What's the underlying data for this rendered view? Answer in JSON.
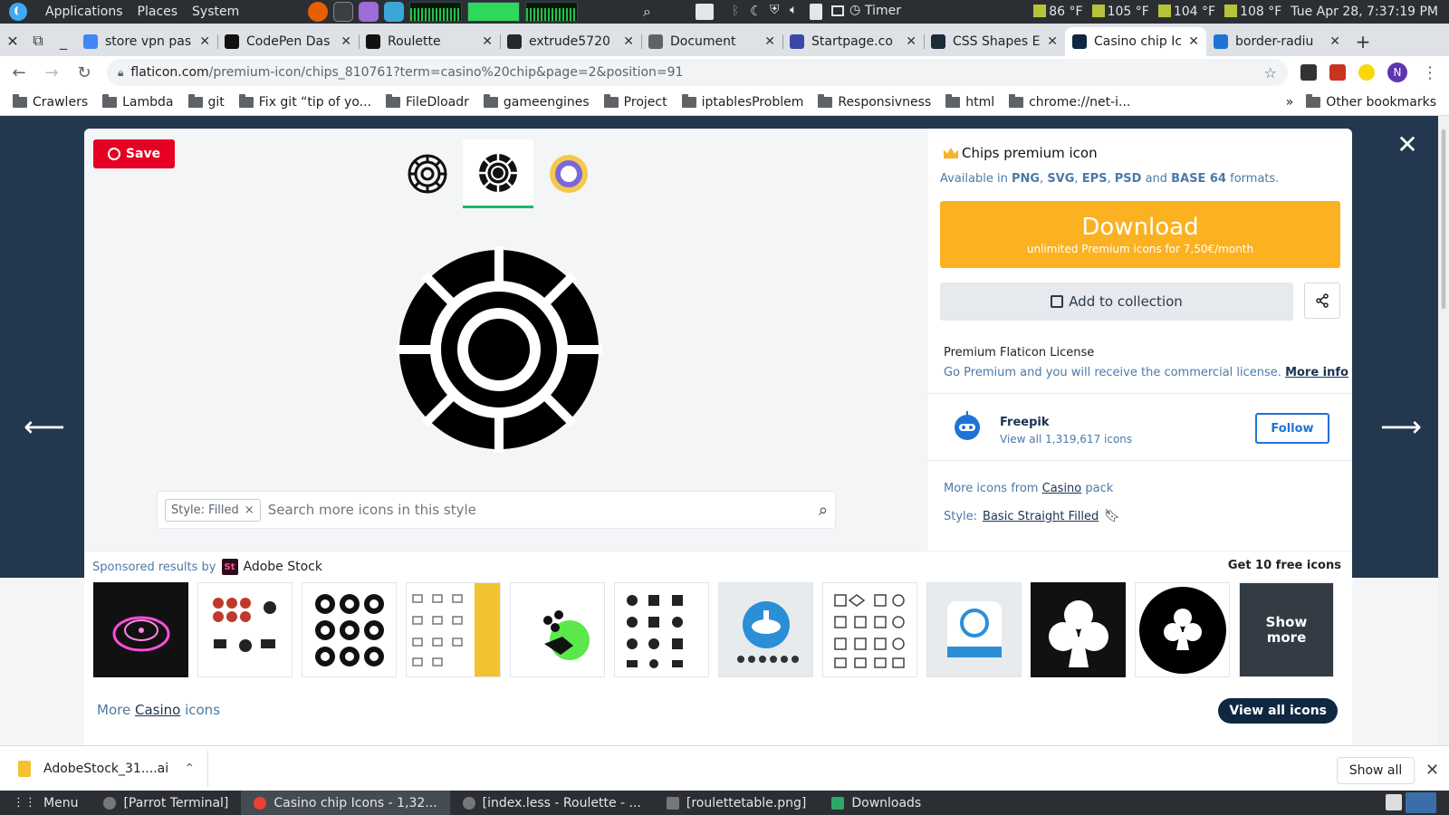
{
  "os_panel": {
    "menus": [
      "Applications",
      "Places",
      "System"
    ],
    "timer_label": "Timer",
    "temps": [
      "86 °F",
      "105 °F",
      "104 °F",
      "108 °F"
    ],
    "clock": "Tue Apr 28, 7:37:19 PM"
  },
  "tabs": [
    {
      "title": "store vpn pas",
      "fav_color": "#4285f4"
    },
    {
      "title": "CodePen Das",
      "fav_color": "#111111"
    },
    {
      "title": "Roulette",
      "fav_color": "#111111"
    },
    {
      "title": "extrude5720",
      "fav_color": "#24292e"
    },
    {
      "title": "Document",
      "fav_color": "#5f6368"
    },
    {
      "title": "Startpage.co",
      "fav_color": "#3b47a8"
    },
    {
      "title": "CSS Shapes E",
      "fav_color": "#1d2a38"
    },
    {
      "title": "Casino chip Ic",
      "fav_color": "#0f2740"
    },
    {
      "title": "border-radiu",
      "fav_color": "#1f73d6"
    }
  ],
  "address": {
    "domain": "flaticon.com",
    "path": "/premium-icon/chips_810761?term=casino%20chip&page=2&position=91",
    "profile_initial": "N"
  },
  "bookmarks": [
    "Crawlers",
    "Lambda",
    "git",
    "Fix git “tip of yo...",
    "FileDloadr",
    "gameengines",
    "Project",
    "iptablesProblem",
    "Responsivness",
    "html",
    "chrome://net-i..."
  ],
  "bookmarks_other": "Other bookmarks",
  "bookmarks_overflow": "»",
  "modal": {
    "save_label": "Save",
    "close_symbol": "✕",
    "prev_symbol": "⟵",
    "next_symbol": "⟶",
    "style_chip": "Style: Filled",
    "chip_remove": "×",
    "search_placeholder": "Search more icons in this style",
    "title": "Chips premium icon",
    "formats_prefix": "Available in",
    "formats": [
      "PNG",
      "SVG",
      "EPS",
      "PSD",
      "BASE 64"
    ],
    "formats_and": "and",
    "formats_suffix": "formats.",
    "download_main": "Download",
    "download_sub": "unlimited Premium icons for 7,50€/month",
    "add_collection": "Add to collection",
    "license_title": "Premium Flaticon License",
    "license_text": "Go Premium and you will receive the commercial license.",
    "license_link": "More info",
    "author_name": "Freepik",
    "author_count": "View all 1,319,617 icons",
    "follow_label": "Follow",
    "pack_prefix": "More icons from",
    "pack_name": "Casino",
    "pack_suffix": "pack",
    "style_prefix": "Style:",
    "style_name": "Basic Straight Filled",
    "sponsored_prefix": "Sponsored results by",
    "sponsored_brand": "Adobe Stock",
    "sponsored_logo": "St",
    "free_icons": "Get 10 free icons",
    "show_more": "Show more",
    "more_prefix": "More",
    "more_pack": "Casino",
    "more_suffix": "icons",
    "view_all": "View all icons"
  },
  "shelf": {
    "file_name": "AdobeStock_31....ai",
    "show_all": "Show all",
    "close": "✕"
  },
  "taskbar": [
    {
      "label": "Menu"
    },
    {
      "label": "[Parrot Terminal]"
    },
    {
      "label": "Casino chip Icons - 1,32..."
    },
    {
      "label": "[index.less - Roulette - ..."
    },
    {
      "label": "[roulettetable.png]"
    },
    {
      "label": "Downloads"
    }
  ],
  "colors": {
    "download": "#fbb120",
    "pinterest": "#e60023",
    "page_bg": "#23374f",
    "follow": "#1f73d6"
  }
}
